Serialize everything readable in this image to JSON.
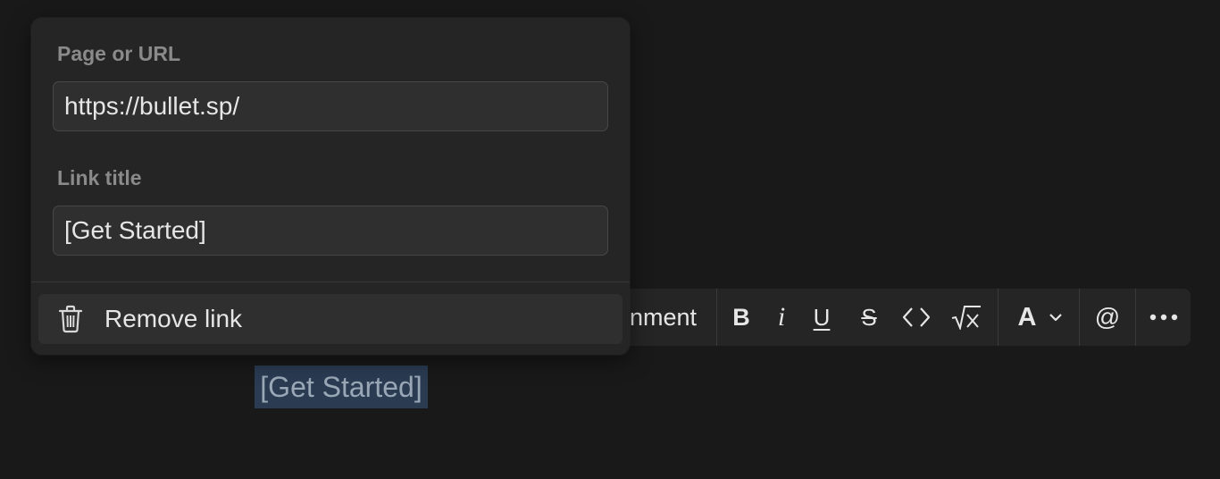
{
  "popover": {
    "url_label": "Page or URL",
    "url_value": "https://bullet.sp/",
    "title_label": "Link title",
    "title_value": "[Get Started]",
    "remove_label": "Remove link",
    "remove_icon": "trash-icon"
  },
  "toolbar": {
    "comment_label": "nment",
    "bold_label": "B",
    "italic_label": "i",
    "underline_label": "U",
    "strike_label": "S",
    "code_icon": "code-icon",
    "equation_icon": "equation-icon",
    "color_label": "A",
    "mention_label": "@",
    "more_icon": "more-icon"
  },
  "editor": {
    "selected_text": "[Get Started]"
  }
}
